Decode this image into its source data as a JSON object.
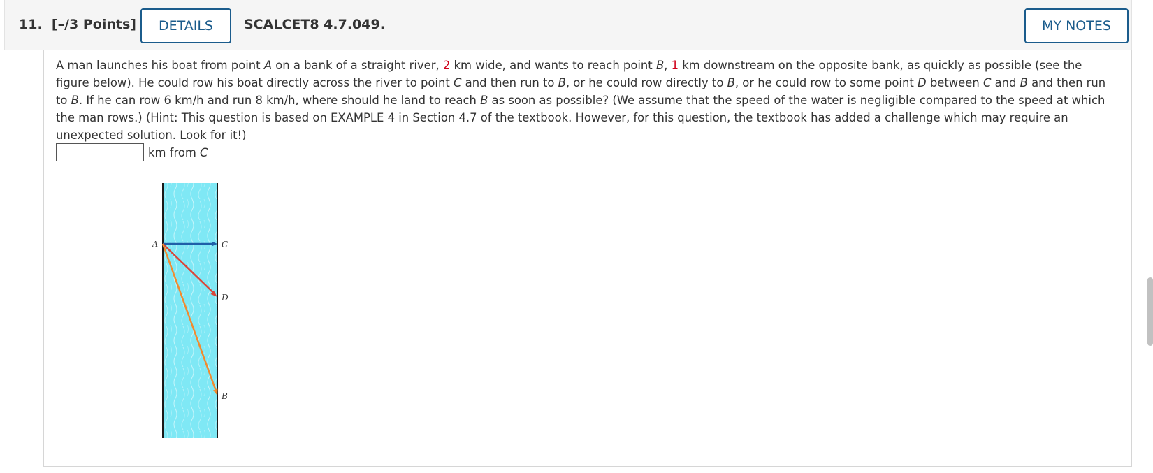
{
  "header": {
    "question_number": "11.",
    "points": "[–/3 Points]",
    "details_label": "DETAILS",
    "problem_code": "SCALCET8 4.7.049.",
    "notes_label": "MY NOTES"
  },
  "question": {
    "t1": "A man launches his boat from point ",
    "pA": "A",
    "t2": " on a bank of a straight river, ",
    "width_value": "2",
    "t3": " km wide, and wants to reach point ",
    "pB": "B",
    "t4": ", ",
    "downstream_value": "1",
    "t5": " km downstream on the opposite bank, as quickly as possible (see the figure below). He could row his boat directly across the river to point ",
    "pC": "C",
    "t6": " and then run to ",
    "pB2": "B",
    "t7": ", or he could row directly to ",
    "pB3": "B",
    "t8": ", or he could row to some point ",
    "pD": "D",
    "t9": " between ",
    "pC2": "C",
    "t10": " and ",
    "pB4": "B",
    "t11": " and then run to ",
    "pB5": "B",
    "t12": ". If he can row 6 km/h and run 8 km/h, where should he land to reach ",
    "pB6": "B",
    "t13": " as soon as possible? (We assume that the speed of the water is negligible compared to the speed at which the man rows.) (Hint: This question is based on EXAMPLE 4 in Section 4.7 of the textbook. However, for this question, the textbook has added a challenge which may require an unexpected solution. Look for it!)"
  },
  "answer": {
    "value": "",
    "unit_text": "km from ",
    "unit_point": "C"
  },
  "figure": {
    "label_a": "A",
    "label_c": "C",
    "label_d": "D",
    "label_b": "B",
    "colors": {
      "water": "#7fe8f5",
      "bank": "#1a1a1a",
      "arrow_ac": "#1f5fa8",
      "arrow_ad": "#d9473a",
      "arrow_ab": "#f28a2e"
    }
  }
}
